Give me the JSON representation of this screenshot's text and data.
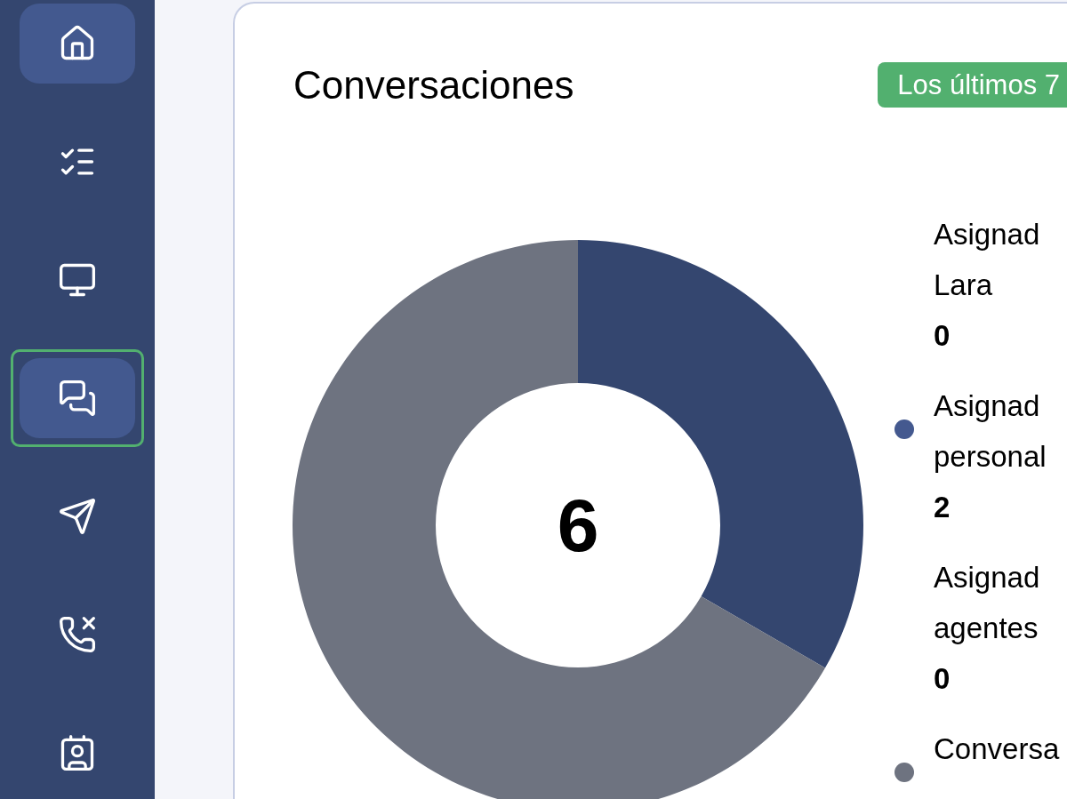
{
  "sidebar": {
    "items": [
      {
        "selected": true,
        "highlighted": false
      },
      {
        "selected": false,
        "highlighted": false
      },
      {
        "selected": false,
        "highlighted": false
      },
      {
        "selected": true,
        "highlighted": true
      },
      {
        "selected": false,
        "highlighted": false
      },
      {
        "selected": false,
        "highlighted": false
      },
      {
        "selected": false,
        "highlighted": false
      }
    ]
  },
  "card": {
    "title": "Conversaciones",
    "badge": "Los últimos 7",
    "total": "6",
    "legend": [
      {
        "lines": [
          "Asignad",
          "Lara"
        ],
        "value": "0"
      },
      {
        "lines": [
          "Asignad",
          "personal"
        ],
        "value": "2",
        "color": "#44598f"
      },
      {
        "lines": [
          "Asignad",
          "agentes"
        ],
        "value": "0"
      },
      {
        "lines": [
          "Conversa"
        ],
        "color": "#6e7380"
      }
    ]
  }
}
